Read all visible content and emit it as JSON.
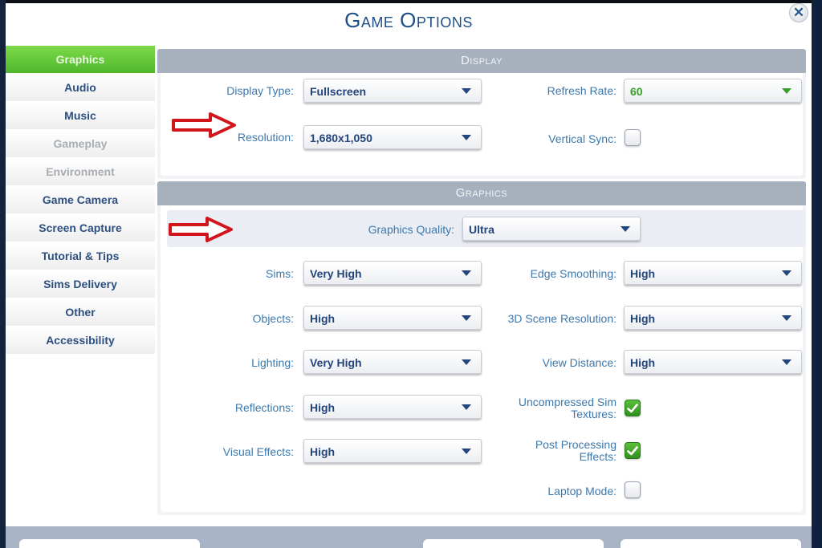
{
  "window": {
    "title": "Game Options",
    "close_icon": "close-icon"
  },
  "sidebar": {
    "items": [
      {
        "label": "Graphics",
        "state": "active"
      },
      {
        "label": "Audio",
        "state": "normal"
      },
      {
        "label": "Music",
        "state": "normal"
      },
      {
        "label": "Gameplay",
        "state": "disabled"
      },
      {
        "label": "Environment",
        "state": "disabled"
      },
      {
        "label": "Game Camera",
        "state": "normal"
      },
      {
        "label": "Screen Capture",
        "state": "normal"
      },
      {
        "label": "Tutorial & Tips",
        "state": "normal"
      },
      {
        "label": "Sims Delivery",
        "state": "normal"
      },
      {
        "label": "Other",
        "state": "normal"
      },
      {
        "label": "Accessibility",
        "state": "normal"
      }
    ]
  },
  "display": {
    "header": "Display",
    "display_type": {
      "label": "Display Type:",
      "value": "Fullscreen"
    },
    "resolution": {
      "label": "Resolution:",
      "value": "1,680x1,050"
    },
    "refresh_rate": {
      "label": "Refresh Rate:",
      "value": "60"
    },
    "vertical_sync": {
      "label": "Vertical Sync:",
      "checked": false
    }
  },
  "graphics": {
    "header": "Graphics",
    "graphics_quality": {
      "label": "Graphics Quality:",
      "value": "Ultra"
    },
    "sims": {
      "label": "Sims:",
      "value": "Very High"
    },
    "objects": {
      "label": "Objects:",
      "value": "High"
    },
    "lighting": {
      "label": "Lighting:",
      "value": "Very High"
    },
    "reflections": {
      "label": "Reflections:",
      "value": "High"
    },
    "visual_effects": {
      "label": "Visual Effects:",
      "value": "High"
    },
    "edge_smoothing": {
      "label": "Edge Smoothing:",
      "value": "High"
    },
    "scene_resolution": {
      "label": "3D Scene Resolution:",
      "value": "High"
    },
    "view_distance": {
      "label": "View Distance:",
      "value": "High"
    },
    "uncompressed_textures": {
      "label": "Uncompressed Sim Textures:",
      "checked": true
    },
    "post_processing": {
      "label": "Post Processing Effects:",
      "checked": true
    },
    "laptop_mode": {
      "label": "Laptop Mode:",
      "checked": false
    }
  },
  "annotations": {
    "arrow_color": "#d0151b",
    "arrows": [
      "resolution",
      "graphics-quality"
    ]
  },
  "colors": {
    "accent_green": "#5cc03a",
    "label_blue": "#3c78ad",
    "value_navy": "#23457d",
    "header_gray": "#a7b0bd"
  }
}
